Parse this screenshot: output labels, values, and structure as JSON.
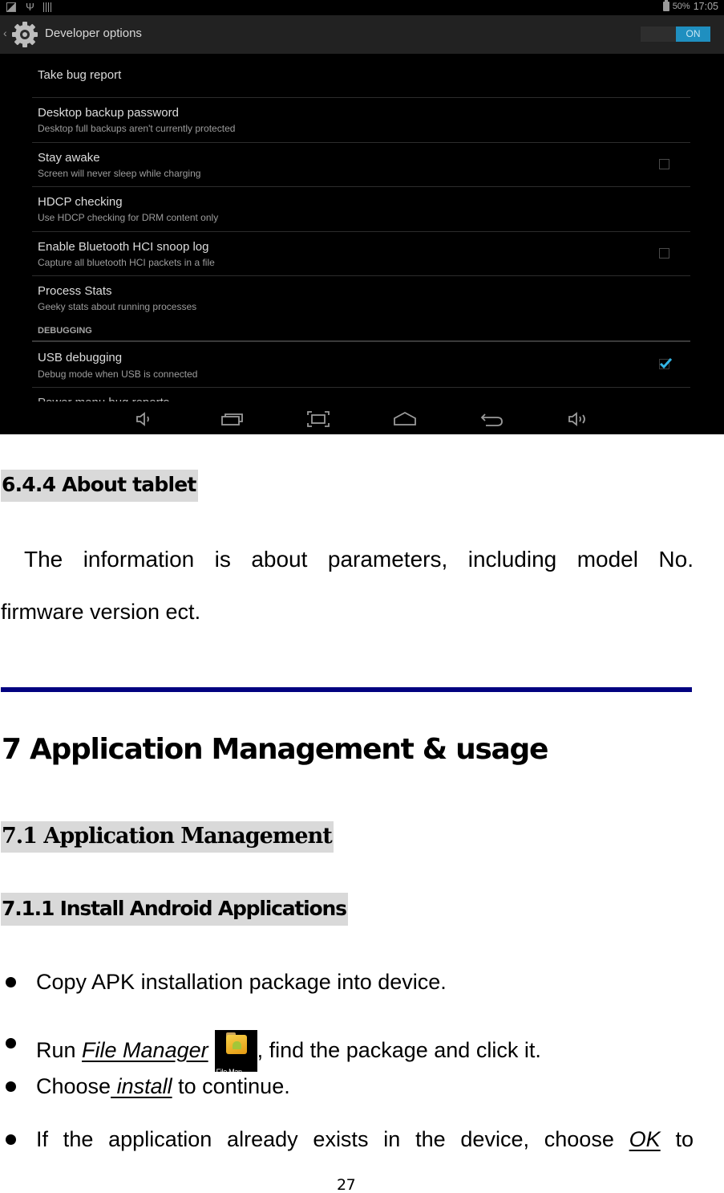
{
  "screenshot": {
    "status_bar": {
      "left_icons": [
        "image-notification-icon",
        "usb-icon",
        "barcode-icon"
      ],
      "battery_icon": "battery-charging-icon",
      "battery_percent": "50%",
      "time": "17:05"
    },
    "action_bar": {
      "back_icon": "chevron-left-icon",
      "app_icon": "gear-icon",
      "title": "Developer options",
      "master_switch": {
        "label": "ON",
        "state": true,
        "accent_color": "#1f8fc0"
      }
    },
    "settings": [
      {
        "title": "Take bug report",
        "subtitle": "",
        "checkbox": null
      },
      {
        "title": "Desktop backup password",
        "subtitle": "Desktop full backups aren't currently protected",
        "checkbox": null
      },
      {
        "title": "Stay awake",
        "subtitle": "Screen will never sleep while charging",
        "checkbox": false
      },
      {
        "title": "HDCP checking",
        "subtitle": "Use HDCP checking for DRM content only",
        "checkbox": null
      },
      {
        "title": "Enable Bluetooth HCI snoop log",
        "subtitle": "Capture all bluetooth HCI packets in a file",
        "checkbox": false
      },
      {
        "title": "Process Stats",
        "subtitle": "Geeky stats about running processes",
        "checkbox": null
      }
    ],
    "category": "DEBUGGING",
    "debug_settings": [
      {
        "title": "USB debugging",
        "subtitle": "Debug mode when USB is connected",
        "checkbox": true
      }
    ],
    "cutoff_item": "Power menu bug reports",
    "nav_bar": [
      "volume-down-icon",
      "recent-apps-icon",
      "screenshot-icon",
      "home-icon",
      "back-icon",
      "volume-up-icon"
    ]
  },
  "document": {
    "section_644": "6.4.4 About tablet",
    "about_para_line1": "The information is about parameters, including model No.",
    "about_para_line2": "firmware version ect.",
    "rule_color": "#020280",
    "chapter_7": "7 Application Management & usage",
    "section_71": "7.1 Application Management",
    "section_711": "7.1.1 Install Android Applications",
    "bullets": {
      "b1": "Copy APK installation package into device.",
      "b2_pre": "Run ",
      "b2_link": "File Manager",
      "b2_icon_label": "File Man..",
      "b2_post": ", find the package and click it.",
      "b3_pre": "Choose",
      "b3_link": " install",
      "b3_post": " to continue.",
      "b4_pre": "If the application already exists in the device, choose ",
      "b4_link": "OK",
      "b4_post": " to"
    },
    "page_number": "27"
  }
}
